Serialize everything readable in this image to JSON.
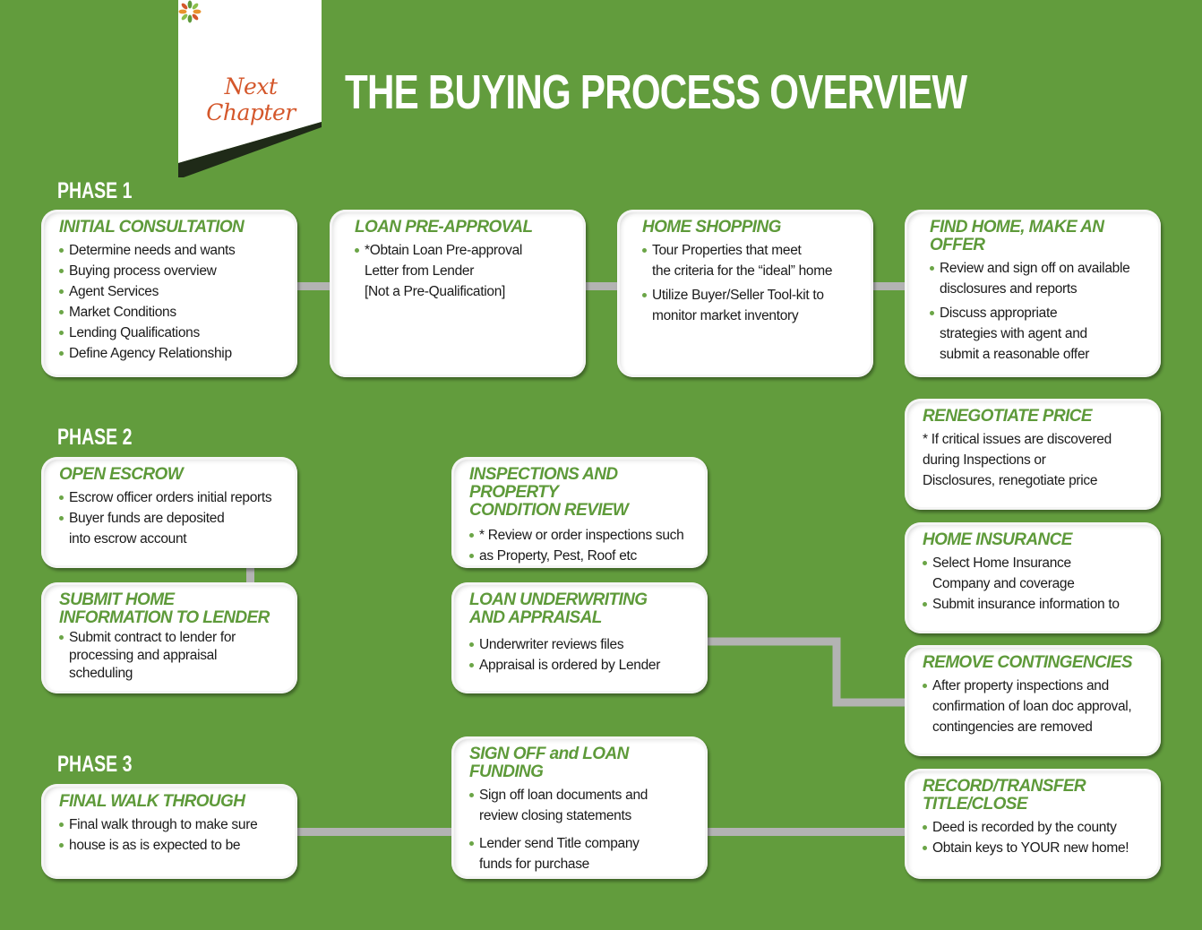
{
  "header": {
    "logo_text": "Next Chapter",
    "title": "THE BUYING PROCESS OVERVIEW"
  },
  "colors": {
    "background": "#629c3d",
    "card_title": "#5e9a3a",
    "arrow_head": "#5e9a3a",
    "arrow_shaft": "#b3b3b3",
    "logo_text": "#d4572b"
  },
  "phases": [
    {
      "label": "PHASE 1"
    },
    {
      "label": "PHASE 2"
    },
    {
      "label": "PHASE 3"
    }
  ],
  "cards": {
    "initial_consultation": {
      "title": "INITIAL CONSULTATION",
      "items": [
        "Determine needs and wants",
        "Buying process overview",
        "Agent Services",
        "Market Conditions",
        "Lending Qualifications",
        "Define Agency Relationship"
      ]
    },
    "loan_preapproval": {
      "title": "LOAN PRE-APPROVAL",
      "items": [
        "*Obtain Loan Pre-approval",
        "Letter from Lender",
        "[Not a Pre-Qualification]"
      ]
    },
    "home_shopping": {
      "title": "HOME SHOPPING",
      "items": [
        "Tour Properties that meet",
        "the criteria for the “ideal” home",
        "Utilize Buyer/Seller Tool-kit to",
        "monitor market inventory"
      ]
    },
    "find_home": {
      "title": "FIND HOME, MAKE AN OFFER",
      "items": [
        "Review and sign off on available",
        "disclosures and reports",
        "Discuss appropriate",
        "strategies with agent and",
        "submit a reasonable offer"
      ]
    },
    "renegotiate_price": {
      "title": "RENEGOTIATE PRICE",
      "text": [
        "* If critical issues are discovered",
        "during Inspections or",
        "Disclosures, renegotiate price"
      ]
    },
    "open_escrow": {
      "title": "OPEN ESCROW",
      "items": [
        "Escrow officer orders initial reports",
        "Buyer funds are deposited",
        "into escrow account"
      ]
    },
    "inspections": {
      "title_line1": "INSPECTIONS AND PROPERTY",
      "title_line2": "CONDITION REVIEW",
      "items": [
        "* Review or order inspections such",
        "as Property, Pest, Roof etc"
      ]
    },
    "home_insurance": {
      "title": "HOME INSURANCE",
      "items": [
        "Select Home Insurance",
        "Company and coverage",
        "Submit insurance information to"
      ]
    },
    "submit_home_info": {
      "title_line1": "SUBMIT HOME",
      "title_line2": "INFORMATION TO LENDER",
      "items": [
        "Submit contract to lender for",
        "processing and appraisal",
        "scheduling"
      ]
    },
    "loan_underwriting": {
      "title_line1": "LOAN UNDERWRITING",
      "title_line2": "AND APPRAISAL",
      "items": [
        "Underwriter reviews files",
        "Appraisal is ordered by Lender"
      ]
    },
    "remove_contingencies": {
      "title": "REMOVE CONTINGENCIES",
      "items": [
        "After property inspections and",
        "confirmation of loan doc approval,",
        "contingencies are removed"
      ]
    },
    "final_walk": {
      "title": "FINAL WALK THROUGH",
      "items": [
        "Final walk through to make sure",
        "house is as is expected to be"
      ]
    },
    "sign_off": {
      "title": "SIGN OFF and LOAN FUNDING",
      "items": [
        "Sign off loan documents and",
        "review closing statements",
        "Lender send Title company",
        "funds for purchase"
      ]
    },
    "record_transfer": {
      "title": "RECORD/TRANSFER TITLE/CLOSE",
      "items": [
        "Deed is recorded by the county",
        "Obtain keys to YOUR new home!"
      ]
    }
  }
}
